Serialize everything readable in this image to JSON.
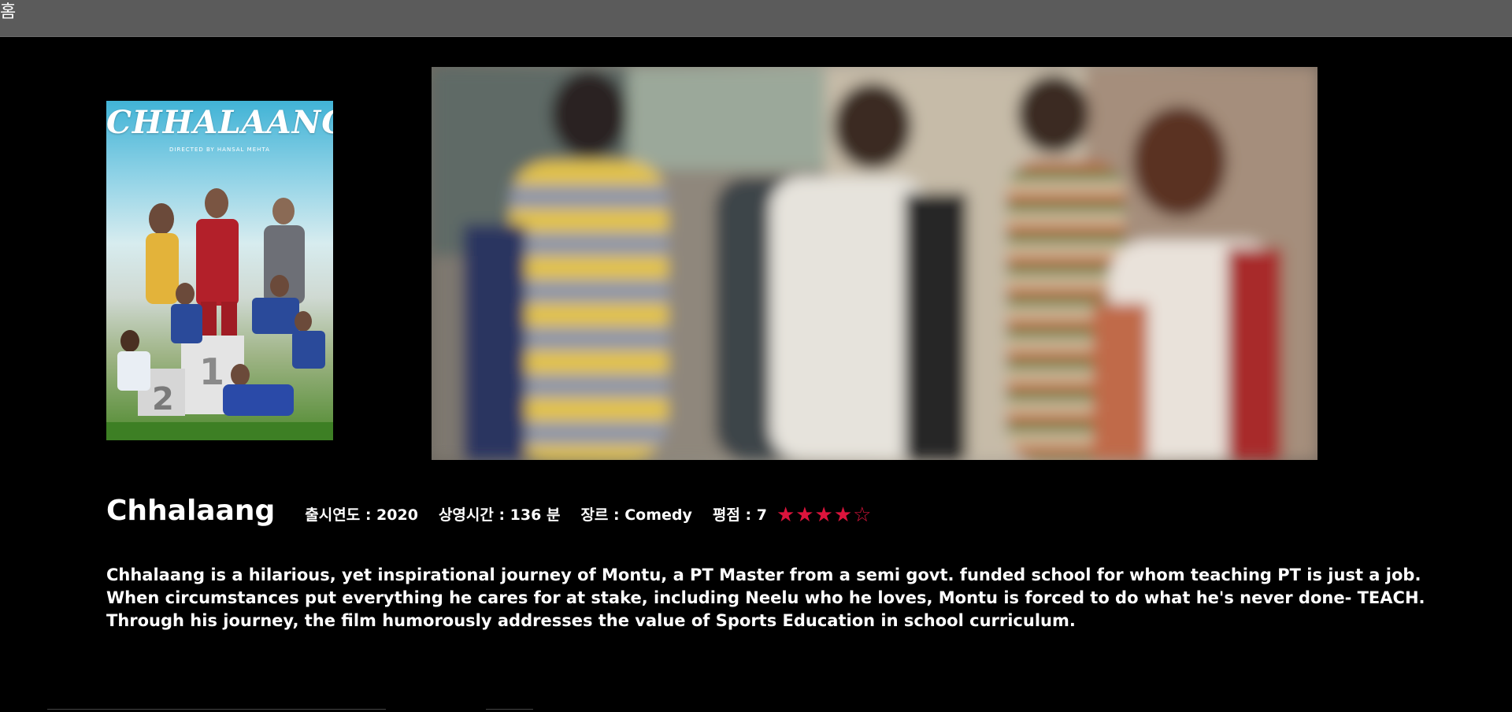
{
  "nav": {
    "home_label": "홈"
  },
  "movie": {
    "title": "Chhalaang",
    "poster_title": "CHHALAANG",
    "poster_credit": "DIRECTED BY HANSAL MEHTA",
    "release_year_label": "출시연도 : 2020",
    "runtime_label": "상영시간 : 136 분",
    "genre_label": "장르 : Comedy",
    "rating_label": "평점 : 7",
    "rating_stars": "★★★★☆",
    "rating_stars_value": 4,
    "rating_stars_max": 5,
    "overview": "Chhalaang is a hilarious, yet inspirational journey of Montu, a PT Master from a semi govt. funded school for whom teaching PT is just a job. When circumstances put everything he cares for at stake, including Neelu who he loves, Montu is forced to do what he's never done- TEACH. Through his journey, the film humorously addresses the value of Sports Education in school curriculum."
  },
  "colors": {
    "background": "#000000",
    "topbar": "#5b5b5b",
    "star": "#dc143c",
    "text": "#ffffff"
  }
}
